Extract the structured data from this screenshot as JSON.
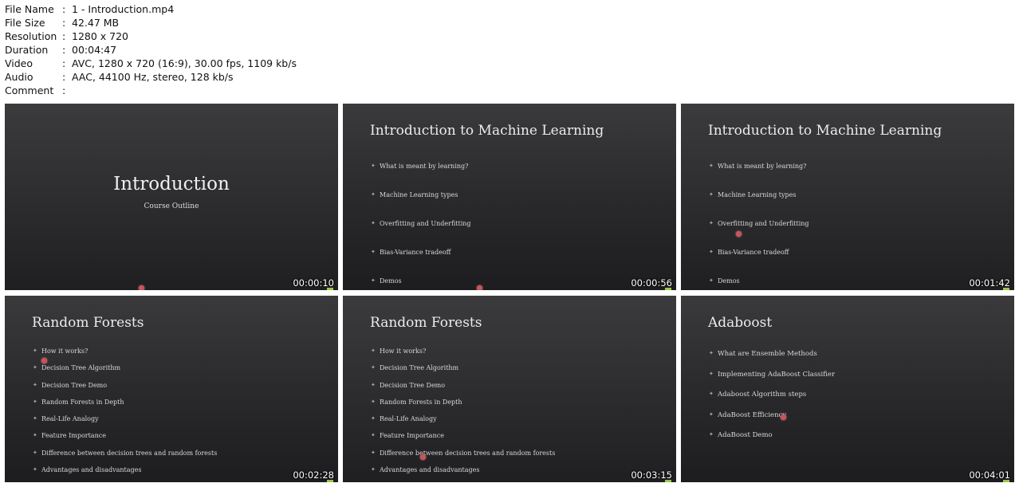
{
  "meta": [
    {
      "key": "File Name",
      "value": "1 - Introduction.mp4"
    },
    {
      "key": "File Size",
      "value": "42.47 MB"
    },
    {
      "key": "Resolution",
      "value": "1280 x 720"
    },
    {
      "key": "Duration",
      "value": "00:04:47"
    },
    {
      "key": "Video",
      "value": "AVC, 1280 x 720 (16:9), 30.00 fps, 1109 kb/s"
    },
    {
      "key": "Audio",
      "value": "AAC, 44100 Hz, stereo, 128 kb/s"
    },
    {
      "key": "Comment",
      "value": ""
    }
  ],
  "separator": ":",
  "thumbnails": [
    {
      "kind": "title",
      "title": "Introduction",
      "subtitle": "Course Outline",
      "timestamp": "00:00:10",
      "bullets": []
    },
    {
      "kind": "list",
      "title": "Introduction to Machine Learning",
      "timestamp": "00:00:56",
      "bullets": [
        "What is meant by learning?",
        "Machine Learning types",
        "Overfitting and Underfitting",
        "Bias-Variance tradeoff",
        "Demos"
      ]
    },
    {
      "kind": "list",
      "title": "Introduction to Machine Learning",
      "timestamp": "00:01:42",
      "bullets": [
        "What is meant by learning?",
        "Machine Learning types",
        "Overfitting and Underfitting",
        "Bias-Variance tradeoff",
        "Demos"
      ]
    },
    {
      "kind": "list",
      "title": "Random Forests",
      "timestamp": "00:02:28",
      "bullets": [
        "How it works?",
        "Decision Tree Algorithm",
        "Decision Tree Demo",
        "Random Forests in Depth",
        "Real-Life Analogy",
        "Feature Importance",
        "Difference between decision trees and random forests",
        "Advantages and disadvantages"
      ]
    },
    {
      "kind": "list",
      "title": "Random Forests",
      "timestamp": "00:03:15",
      "bullets": [
        "How it works?",
        "Decision Tree Algorithm",
        "Decision Tree Demo",
        "Random Forests in Depth",
        "Real-Life Analogy",
        "Feature Importance",
        "Difference between decision trees and random forests",
        "Advantages and disadvantages"
      ]
    },
    {
      "kind": "list",
      "title": "Adaboost",
      "timestamp": "00:04:01",
      "bullets": [
        "What are Ensemble Methods",
        "Implementing AdaBoost Classifier",
        "Adaboost Algorithm steps",
        "AdaBoost Efficiency",
        "AdaBoost Demo"
      ]
    }
  ],
  "colors": {
    "cursor": "#c8555c",
    "corner_mark": "#9ec64a",
    "slide_bg": "#2c2c2e"
  },
  "icons": {
    "bullet": "diamond-bullet-icon",
    "cursor": "cursor-highlight-icon"
  }
}
